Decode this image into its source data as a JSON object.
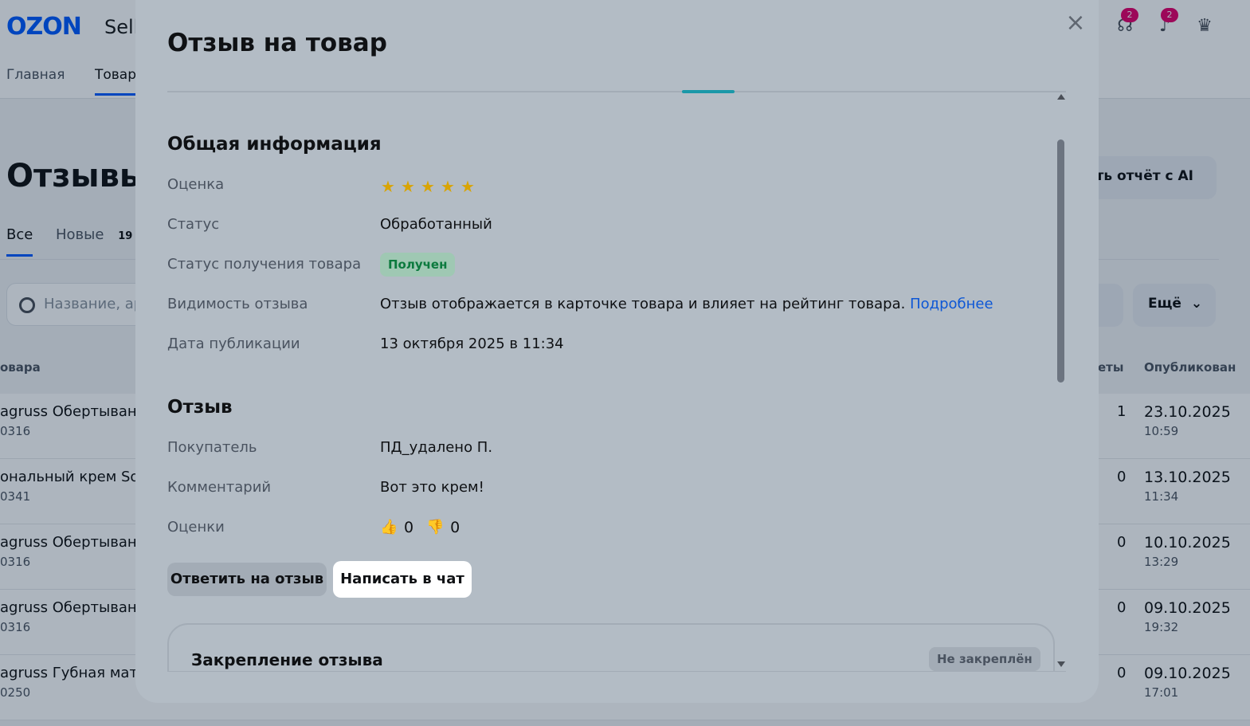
{
  "background": {
    "logo": "OZON",
    "logo_suffix": "Sell",
    "header_badges": [
      "2",
      "2"
    ],
    "nav": [
      "Главная",
      "Товар"
    ],
    "page_title": "Отзывы",
    "ai_button": "ать отчёт с AI",
    "tabs": [
      {
        "label": "Все"
      },
      {
        "label": "Новые",
        "count": "19"
      }
    ],
    "search_placeholder": "Название, ар",
    "more_button": "Ещё",
    "columns": {
      "product": "овара",
      "answers": "еты",
      "published": "Опубликован"
    },
    "rows": [
      {
        "name": "agruss Обертывани",
        "sku": "0316",
        "count": "1",
        "date": "23.10.2025",
        "time": "10:59"
      },
      {
        "name": "ональный крем Sof",
        "sku": "0341",
        "count": "0",
        "date": "13.10.2025",
        "time": "11:34"
      },
      {
        "name": "agruss Обертывани",
        "sku": "0316",
        "count": "0",
        "date": "10.10.2025",
        "time": "13:29"
      },
      {
        "name": "agruss Обертывани",
        "sku": "0316",
        "count": "0",
        "date": "09.10.2025",
        "time": "19:32"
      },
      {
        "name": "agruss Губная мат",
        "sku": "0250",
        "count": "0",
        "date": "09.10.2025",
        "time": "17:01"
      }
    ]
  },
  "modal": {
    "title": "Отзыв на товар",
    "close_icon": "×",
    "general": {
      "title": "Общая информация",
      "rating_label": "Оценка",
      "rating_stars": 5,
      "status_label": "Статус",
      "status_value": "Обработанный",
      "receipt_label": "Статус получения товара",
      "receipt_value": "Получен",
      "visibility_label": "Видимость отзыва",
      "visibility_value": "Отзыв отображается в карточке товара и влияет на рейтинг товара.",
      "visibility_link": "Подробнее",
      "date_label": "Дата публикации",
      "date_value": "13 октября 2025 в 11:34"
    },
    "review": {
      "title": "Отзыв",
      "buyer_label": "Покупатель",
      "buyer_value": "ПД_удалено П.",
      "comment_label": "Комментарий",
      "comment_value": "Вот это крем!",
      "votes_label": "Оценки",
      "likes": "0",
      "dislikes": "0"
    },
    "buttons": {
      "reply": "Ответить на отзыв",
      "chat": "Написать в чат"
    },
    "pin": {
      "title": "Закрепление отзыва",
      "status": "Не закреплён"
    }
  },
  "colors": {
    "accent": "#005bff",
    "star": "#d9a404",
    "success_text": "#0c7a3e",
    "link": "#0d57d6"
  }
}
